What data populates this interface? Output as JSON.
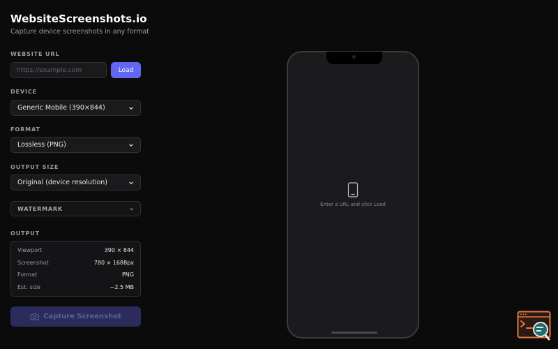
{
  "app": {
    "title": "WebsiteScreenshots.io",
    "subtitle": "Capture device screenshots in any format"
  },
  "website_url": {
    "label": "WEBSITE URL",
    "placeholder": "https://example.com",
    "value": "",
    "load_label": "Load"
  },
  "device": {
    "label": "DEVICE",
    "selected": "Generic Mobile (390×844)"
  },
  "format": {
    "label": "FORMAT",
    "selected": "Lossless (PNG)"
  },
  "output_size": {
    "label": "OUTPUT SIZE",
    "selected": "Original (device resolution)"
  },
  "watermark": {
    "label": "WATERMARK"
  },
  "output": {
    "label": "OUTPUT",
    "rows": [
      {
        "key": "Viewport",
        "value": "390 × 844"
      },
      {
        "key": "Screenshot",
        "value": "780 × 1688px"
      },
      {
        "key": "Format",
        "value": "PNG"
      },
      {
        "key": "Est. size",
        "value": "~2.5 MB"
      }
    ]
  },
  "capture": {
    "label": "Capture Screenshot",
    "icon": "camera-icon",
    "enabled": false
  },
  "preview": {
    "empty_text": "Enter a URL and click Load",
    "icon": "mobile-device-icon"
  },
  "colors": {
    "accent": "#6366f1",
    "background": "#0b0b0c",
    "capture_disabled": "#2b2c5c",
    "widget_orange": "#e07b45",
    "widget_teal": "#1f6b70"
  }
}
